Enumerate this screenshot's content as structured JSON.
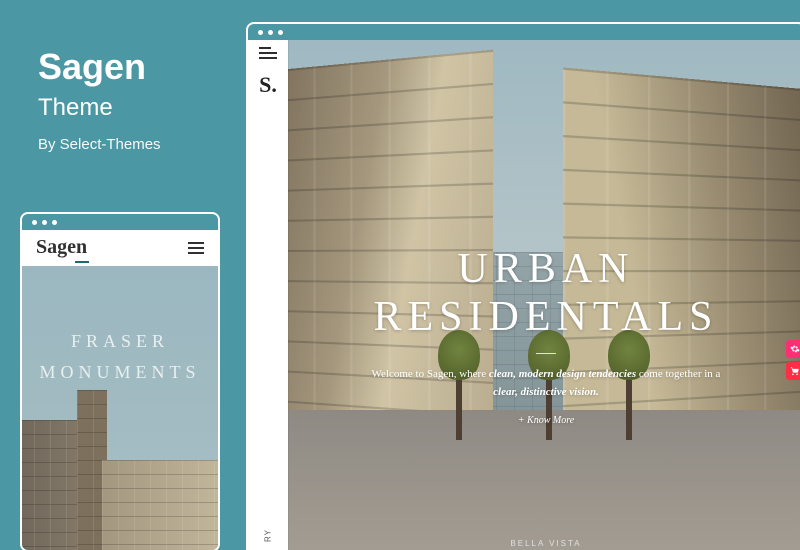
{
  "header": {
    "title": "Sagen",
    "subtitle": "Theme",
    "byline": "By Select-Themes"
  },
  "mobile": {
    "brand": "Sagen",
    "hero_line1": "FRASER",
    "hero_line2": "MONUMENTS"
  },
  "desktop": {
    "logo": "S.",
    "sidebar_vertical": "RY",
    "hero_title": "URBAN RESIDENTALS",
    "hero_welcome_a": "Welcome to Sagen, where ",
    "hero_welcome_em1": "clean, modern design tendencies",
    "hero_welcome_b": " come together in a ",
    "hero_welcome_em2": "clear, distinctive vision.",
    "know_more": "+ Know More",
    "bottom_nav_center": "BELLA VISTA",
    "side_icon_a": "cog-icon",
    "side_icon_b": "cart-icon"
  },
  "colors": {
    "bg": "#4b97a3",
    "accent_pink": "#ff2e74",
    "accent_red": "#ff2e44"
  }
}
